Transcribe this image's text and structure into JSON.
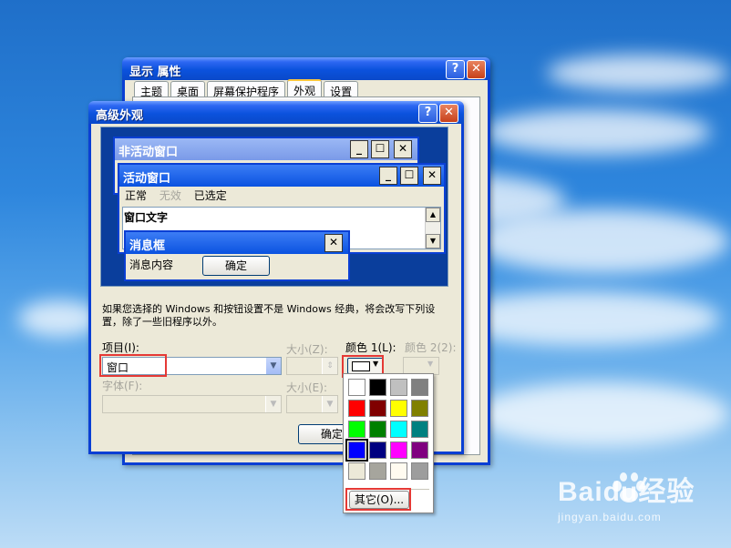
{
  "watermark": {
    "brand": "Baidu经验",
    "url": "jingyan.baidu.com"
  },
  "display_window": {
    "title": "显示 属性",
    "tabs": [
      "主题",
      "桌面",
      "屏幕保护程序",
      "外观",
      "设置"
    ],
    "active_tab": "外观"
  },
  "advanced_window": {
    "title": "高级外观",
    "preview": {
      "inactive_title": "非活动窗口",
      "active_title": "活动窗口",
      "menu": {
        "normal": "正常",
        "disabled": "无效",
        "selected": "已选定"
      },
      "window_text": "窗口文字",
      "message_box_title": "消息框",
      "message_text": "消息内容",
      "ok": "确定"
    },
    "note": "如果您选择的 Windows 和按钮设置不是 Windows 经典，将会改写下列设置，除了一些旧程序以外。",
    "labels": {
      "item": "项目(I):",
      "size1": "大小(Z):",
      "color1": "颜色 1(L):",
      "color2": "颜色 2(2):",
      "font": "字体(F):",
      "size2": "大小(E):"
    },
    "item_value": "窗口",
    "ok": "确定"
  },
  "color_palette": {
    "colors": [
      "#ffffff",
      "#000000",
      "#c0c0c0",
      "#808080",
      "#ff0000",
      "#800000",
      "#ffff00",
      "#808000",
      "#00ff00",
      "#008000",
      "#00ffff",
      "#008080",
      "#0000ff",
      "#000080",
      "#ff00ff",
      "#800080",
      "#ece9d8",
      "#a6a59d",
      "#fffbf0",
      "#9d9d9d"
    ],
    "selected_color": "#0000ff",
    "other": "其它(O)..."
  },
  "highlight_color": "#e53935"
}
